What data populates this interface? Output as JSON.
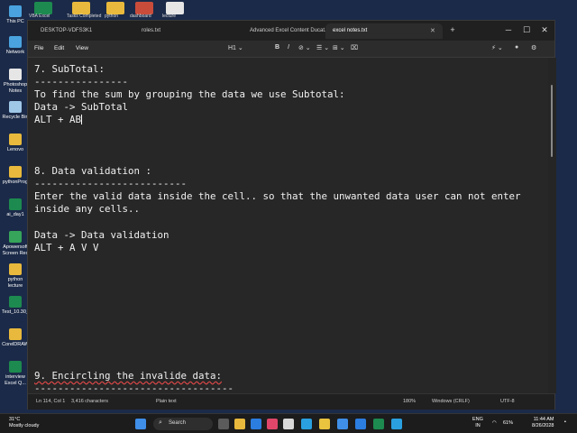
{
  "desktop": {
    "top_icons": [
      "VBA Excel",
      "Tasks Completed",
      "python",
      "dashboard",
      "lecture"
    ],
    "items": [
      {
        "label": "This PC",
        "icon": "computer-icon",
        "color": "#4aa3df"
      },
      {
        "label": "Network",
        "icon": "network-icon",
        "color": "#4aa3df"
      },
      {
        "label": "Photoshop Notes",
        "icon": "document-icon",
        "color": "#e6e6e6"
      },
      {
        "label": "Recycle Bin",
        "icon": "recycle-bin-icon",
        "color": "#9fc7e8"
      },
      {
        "label": "Lenovo",
        "icon": "folder-icon",
        "color": "#e8b93c"
      },
      {
        "label": "pythonProg",
        "icon": "folder-icon",
        "color": "#e8b93c"
      },
      {
        "label": "ai_day1",
        "icon": "excel-icon",
        "color": "#1d8a4f"
      },
      {
        "label": "Apowersoft Screen Rec",
        "icon": "recorder-icon",
        "color": "#36a45a"
      },
      {
        "label": "python lecture",
        "icon": "folder-icon",
        "color": "#e8b93c"
      },
      {
        "label": "Test_10.30_",
        "icon": "excel-icon",
        "color": "#1d8a4f"
      },
      {
        "label": "CorelDRAW",
        "icon": "folder-icon",
        "color": "#e8b93c"
      },
      {
        "label": "interview Excel Q...",
        "icon": "excel-icon",
        "color": "#1d8a4f"
      }
    ]
  },
  "window": {
    "tabs": [
      {
        "label": "DESKTOP-VDFS3K1"
      },
      {
        "label": "roles.txt"
      },
      {
        "label": "Advanced Excel Content Ducat.txt"
      },
      {
        "label": "excel notes.txt",
        "active": true
      }
    ],
    "new_tab": "+",
    "controls": {
      "minimize": "─",
      "maximize": "☐",
      "close": "✕"
    },
    "menu": [
      "File",
      "Edit",
      "View"
    ],
    "toolbar": {
      "heading": "H1 ⌄",
      "bold": "B",
      "italic": "I",
      "link": "⊘ ⌄",
      "list": "☰ ⌄",
      "table": "⊞ ⌄",
      "clear": "⌧"
    },
    "right_tools": {
      "copilot": "⚡ ⌄",
      "account": "●",
      "settings": "⚙"
    }
  },
  "editor": {
    "lines": [
      "7. SubTotal:",
      "----------------",
      "To find the sum by grouping the data we use Subtotal:",
      "Data -> SubTotal",
      "ALT + AB",
      "8. Data validation :",
      "--------------------------",
      "Enter the valid data inside the cell.. so that the unwanted data user can not enter",
      "inside any cells..",
      "Data -> Data validation",
      "ALT + A V V",
      "9. Encircling the invalide data:",
      "----------------------------------"
    ]
  },
  "status": {
    "position": "Ln 114, Col 1",
    "characters": "3,416 characters",
    "format": "Plain text",
    "zoom": "180%",
    "line_endings": "Windows (CRLF)",
    "encoding": "UTF-8"
  },
  "taskbar": {
    "temperature": "31°C",
    "weather": "Mostly cloudy",
    "search": "Search",
    "language_1": "ENG",
    "language_2": "IN",
    "battery": "61%",
    "time": "11:44 AM",
    "date": "8/26/2028"
  }
}
